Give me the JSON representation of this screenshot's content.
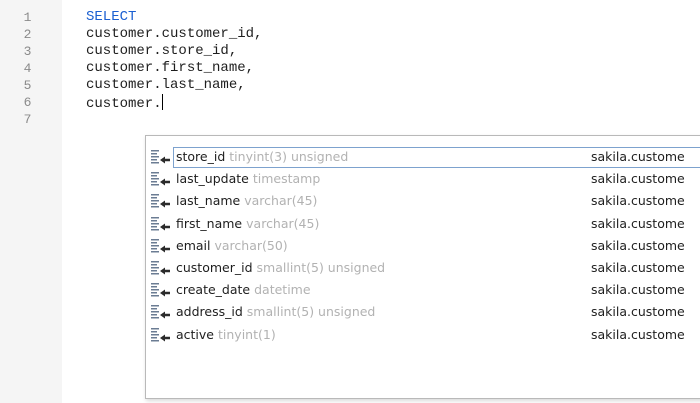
{
  "editor": {
    "lines": [
      {
        "num": "1",
        "text": "SELECT",
        "keyword": true
      },
      {
        "num": "2",
        "text": "customer.customer_id,",
        "keyword": false
      },
      {
        "num": "3",
        "text": "customer.store_id,",
        "keyword": false
      },
      {
        "num": "4",
        "text": "customer.first_name,",
        "keyword": false
      },
      {
        "num": "5",
        "text": "customer.last_name,",
        "keyword": false
      },
      {
        "num": "6",
        "text": "customer.",
        "keyword": false
      },
      {
        "num": "7",
        "text": "",
        "keyword": false
      }
    ]
  },
  "autocomplete": {
    "icon": "column-icon",
    "items": [
      {
        "name": "store_id",
        "type": "tinyint(3) unsigned",
        "table": "sakila.custome",
        "selected": true
      },
      {
        "name": "last_update",
        "type": "timestamp",
        "table": "sakila.custome",
        "selected": false
      },
      {
        "name": "last_name",
        "type": "varchar(45)",
        "table": "sakila.custome",
        "selected": false
      },
      {
        "name": "first_name",
        "type": "varchar(45)",
        "table": "sakila.custome",
        "selected": false
      },
      {
        "name": "email",
        "type": "varchar(50)",
        "table": "sakila.custome",
        "selected": false
      },
      {
        "name": "customer_id",
        "type": "smallint(5) unsigned",
        "table": "sakila.custome",
        "selected": false
      },
      {
        "name": "create_date",
        "type": "datetime",
        "table": "sakila.custome",
        "selected": false
      },
      {
        "name": "address_id",
        "type": "smallint(5) unsigned",
        "table": "sakila.custome",
        "selected": false
      },
      {
        "name": "active",
        "type": "tinyint(1)",
        "table": "sakila.custome",
        "selected": false
      }
    ]
  }
}
